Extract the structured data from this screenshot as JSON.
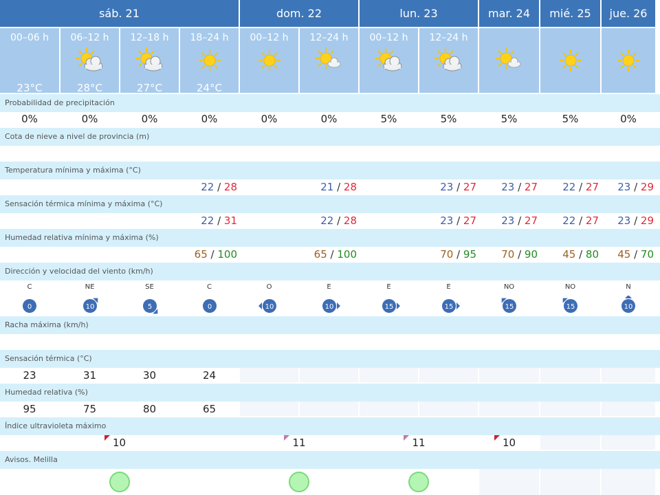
{
  "days": [
    {
      "label": "sáb. 21",
      "cols": 4
    },
    {
      "label": "dom. 22",
      "cols": 2
    },
    {
      "label": "lun. 23",
      "cols": 2
    },
    {
      "label": "mar. 24",
      "cols": 1
    },
    {
      "label": "mié. 25",
      "cols": 1
    },
    {
      "label": "jue. 26",
      "cols": 1
    }
  ],
  "periods": [
    {
      "label": "00–06 h",
      "icon": "moon-icon",
      "temp": "23°C"
    },
    {
      "label": "06–12 h",
      "icon": "sun-cloud-icon",
      "temp": "28°C"
    },
    {
      "label": "12–18 h",
      "icon": "sun-cloud-icon",
      "temp": "27°C"
    },
    {
      "label": "18–24 h",
      "icon": "sun-icon",
      "temp": "24°C"
    },
    {
      "label": "00–12 h",
      "icon": "sun-icon",
      "temp": ""
    },
    {
      "label": "12–24 h",
      "icon": "sun-small-cloud-icon",
      "temp": ""
    },
    {
      "label": "00–12 h",
      "icon": "sun-cloud-icon",
      "temp": ""
    },
    {
      "label": "12–24 h",
      "icon": "sun-cloud-icon",
      "temp": ""
    },
    {
      "label": "",
      "icon": "sun-small-cloud-icon",
      "temp": ""
    },
    {
      "label": "",
      "icon": "sun-icon",
      "temp": ""
    },
    {
      "label": "",
      "icon": "sun-icon",
      "temp": ""
    }
  ],
  "labels": {
    "precip": "Probabilidad de precipitación",
    "snow": "Cota de nieve a nivel de provincia (m)",
    "temp": "Temperatura mínima y máxima (°C)",
    "feels": "Sensación térmica mínima y máxima (°C)",
    "hum": "Humedad relativa mínima y máxima (%)",
    "wind": "Dirección y velocidad del viento (km/h)",
    "gust": "Racha máxima (km/h)",
    "feelsP": "Sensación térmica (°C)",
    "humP": "Humedad relativa (%)",
    "uv": "Índice ultravioleta máximo",
    "warn": "Avisos. Melilla"
  },
  "precip": [
    "0%",
    "0%",
    "0%",
    "0%",
    "0%",
    "0%",
    "5%",
    "5%",
    "5%",
    "5%",
    "0%"
  ],
  "temp": [
    {
      "min": "22",
      "max": "28"
    },
    {
      "min": "21",
      "max": "28"
    },
    {
      "min": "23",
      "max": "27"
    },
    {
      "min": "23",
      "max": "27"
    },
    {
      "min": "22",
      "max": "27"
    },
    {
      "min": "23",
      "max": "29"
    }
  ],
  "feels": [
    {
      "min": "22",
      "max": "31"
    },
    {
      "min": "22",
      "max": "28"
    },
    {
      "min": "23",
      "max": "27"
    },
    {
      "min": "23",
      "max": "27"
    },
    {
      "min": "22",
      "max": "27"
    },
    {
      "min": "23",
      "max": "29"
    }
  ],
  "hum": [
    {
      "min": "65",
      "max": "100"
    },
    {
      "min": "65",
      "max": "100"
    },
    {
      "min": "70",
      "max": "95"
    },
    {
      "min": "70",
      "max": "90"
    },
    {
      "min": "45",
      "max": "80"
    },
    {
      "min": "45",
      "max": "70"
    }
  ],
  "wind": [
    {
      "dir": "C",
      "speed": "0",
      "arrow": "none"
    },
    {
      "dir": "NE",
      "speed": "10",
      "arrow": "ne"
    },
    {
      "dir": "SE",
      "speed": "5",
      "arrow": "se"
    },
    {
      "dir": "C",
      "speed": "0",
      "arrow": "none"
    },
    {
      "dir": "O",
      "speed": "10",
      "arrow": "w"
    },
    {
      "dir": "E",
      "speed": "10",
      "arrow": "e"
    },
    {
      "dir": "E",
      "speed": "15",
      "arrow": "e"
    },
    {
      "dir": "E",
      "speed": "15",
      "arrow": "e"
    },
    {
      "dir": "NO",
      "speed": "15",
      "arrow": "nw"
    },
    {
      "dir": "NO",
      "speed": "15",
      "arrow": "nw"
    },
    {
      "dir": "N",
      "speed": "10",
      "arrow": "n"
    }
  ],
  "feelsP": [
    "23",
    "31",
    "30",
    "24"
  ],
  "humP": [
    "95",
    "75",
    "80",
    "65"
  ],
  "uv": [
    "10",
    "11",
    "11",
    "10"
  ],
  "uvColors": [
    "#d02030",
    "#c07aa8",
    "#c07aa8",
    "#d02030"
  ],
  "colors": {
    "header": "#3d76b8",
    "subheader": "#a7caec",
    "label": "#d5f0fb",
    "min": "#3c5ea8",
    "max": "#e0283a",
    "humMin": "#a05f1d",
    "humMax": "#228b22",
    "windBadge": "#3d6db5",
    "warnGreen": "#b4f5b4"
  }
}
